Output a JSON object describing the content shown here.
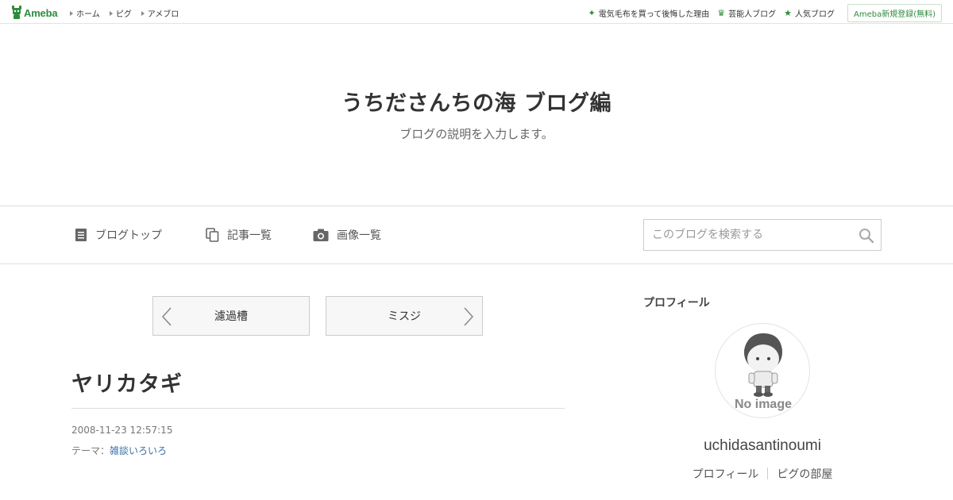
{
  "topbar": {
    "logo_text": "Ameba",
    "nav": [
      "ホーム",
      "ピグ",
      "アメブロ"
    ],
    "right_links": [
      {
        "label": "電気毛布を買って後悔した理由",
        "icon": "sparkle-icon"
      },
      {
        "label": "芸能人ブログ",
        "icon": "crown-icon"
      },
      {
        "label": "人気ブログ",
        "icon": "star-icon"
      }
    ],
    "signup_label": "Ameba新規登録(無料)"
  },
  "header": {
    "title": "うちださんちの海 ブログ編",
    "description": "ブログの説明を入力します。"
  },
  "navbar": {
    "items": [
      {
        "label": "ブログトップ",
        "icon": "document-icon"
      },
      {
        "label": "記事一覧",
        "icon": "copy-icon"
      },
      {
        "label": "画像一覧",
        "icon": "camera-icon"
      }
    ],
    "search_placeholder": "このブログを検索する"
  },
  "pager": {
    "prev_label": "濾過槽",
    "next_label": "ミスジ"
  },
  "entry": {
    "title": "ヤリカタギ",
    "datetime": "2008-11-23 12:57:15",
    "theme_prefix": "テーマ：",
    "theme": "雑談いろいろ"
  },
  "sidebar": {
    "heading": "プロフィール",
    "avatar_text": "No image",
    "username": "uchidasantinoumi",
    "links": [
      "プロフィール",
      "ピグの部屋"
    ]
  },
  "colors": {
    "brand": "#2d8c3c",
    "link": "#3a6fa8"
  }
}
